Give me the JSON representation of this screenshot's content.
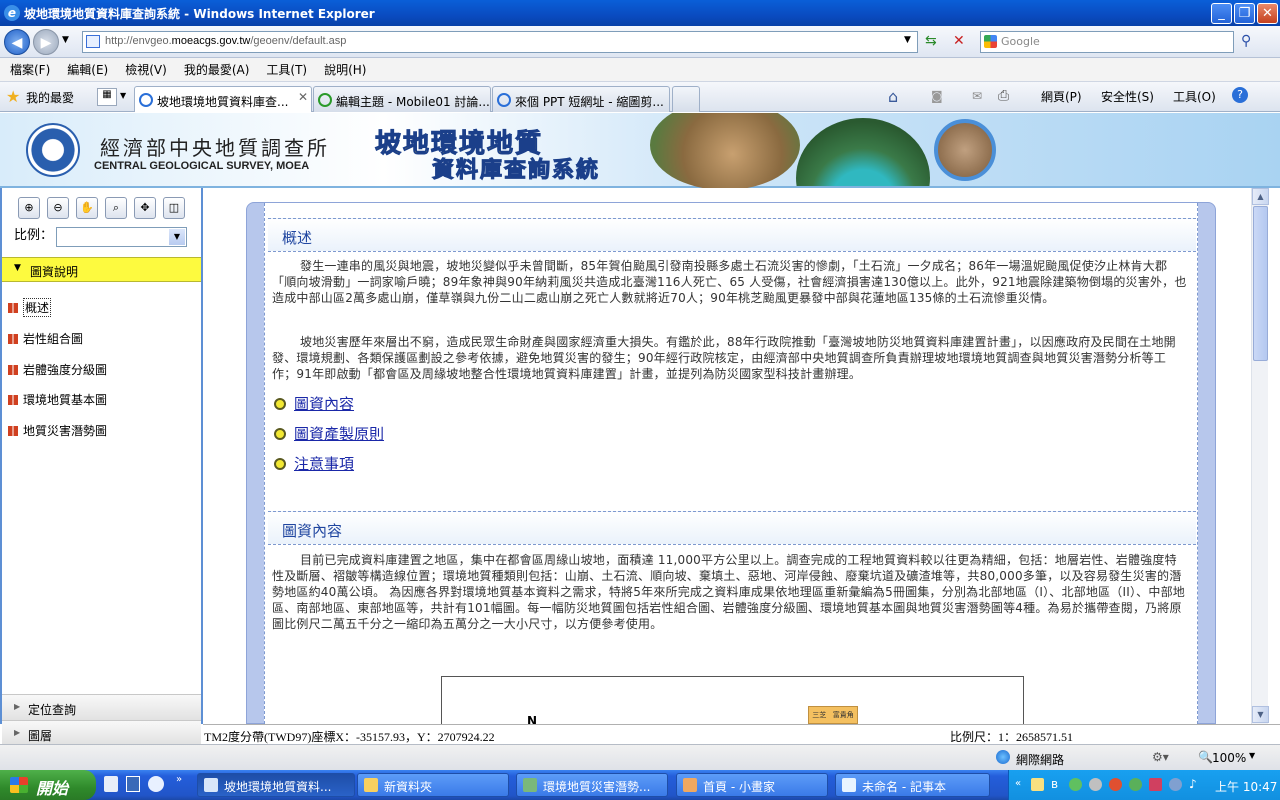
{
  "window": {
    "title": "坡地環境地質資料庫查詢系統 - Windows Internet Explorer"
  },
  "browser": {
    "url_prefix": "http://envgeo.",
    "url_host": "moeacgs.gov.tw",
    "url_path": "/geoenv/default.asp",
    "search_placeholder": "Google",
    "menu": [
      "檔案(F)",
      "編輯(E)",
      "檢視(V)",
      "我的最愛(A)",
      "工具(T)",
      "說明(H)"
    ],
    "favorites_label": "我的最愛",
    "tabs": [
      {
        "label": "坡地環境地質資料庫查..."
      },
      {
        "label": "編輯主題 - Mobile01 討論..."
      },
      {
        "label": "來個 PPT 短網址 - 縮圖剪..."
      }
    ],
    "toolbar_right": {
      "page": "網頁(P)",
      "safety": "安全性(S)",
      "tools": "工具(O)"
    }
  },
  "header": {
    "org_zh": "經濟部中央地質調查所",
    "org_en": "CENTRAL GEOLOGICAL SURVEY, MOEA",
    "system_line1": "坡地環境地質",
    "system_line2": "資料庫查詢系統"
  },
  "sidebar": {
    "scale_label": "比例：",
    "legend_header": "圖資說明",
    "items": [
      {
        "label": "概述"
      },
      {
        "label": "岩性組合圖"
      },
      {
        "label": "岩體強度分級圖"
      },
      {
        "label": "環境地質基本圖"
      },
      {
        "label": "地質災害潛勢圖"
      }
    ],
    "accordion": [
      {
        "label": "定位查詢"
      },
      {
        "label": "圖層"
      }
    ]
  },
  "content": {
    "section1_title": "概述",
    "section1_p1": "發生一連串的風災與地震，坡地災變似乎未曾間斷，85年賀伯颱風引發南投縣多處土石流災害的慘劇，「土石流」一夕成名；86年一場溫妮颱風促使汐止林肯大郡「順向坡滑動」一詞家喻戶曉；89年象神與90年納莉風災共造成北臺灣116人死亡、65 人受傷，社會經濟損害達130億以上。此外，921地震除建築物倒塌的災害外，也造成中部山區2萬多處山崩，僅草嶺與九份二山二處山崩之死亡人數就將近70人；90年桃芝颱風更暴發中部與花蓮地區135條的土石流慘重災情。",
    "section1_p2": "坡地災害歷年來層出不窮，造成民眾生命財產與國家經濟重大損失。有鑑於此，88年行政院推動「臺灣坡地防災地質資料庫建置計畫」，以因應政府及民間在土地開發、環境規劃、各類保護區劃設之參考依據，避免地質災害的發生；90年經行政院核定，由經濟部中央地質調查所負責辦理坡地環境地質調查與地質災害潛勢分析等工作；91年即啟動「都會區及周緣坡地整合性環境地質資料庫建置」計畫，並提列為防災國家型科技計畫辦理。",
    "links": [
      {
        "label": "圖資內容"
      },
      {
        "label": "圖資產製原則"
      },
      {
        "label": "注意事項"
      }
    ],
    "section2_title": "圖資內容",
    "section2_p1": "目前已完成資料庫建置之地區，集中在都會區周緣山坡地，面積達 11,000平方公里以上。調查完成的工程地質資料較以往更為精細，包括：地層岩性、岩體強度特性及斷層、褶皺等構造線位置；環境地質種類則包括：山崩、土石流、順向坡、棄填土、惡地、河岸侵蝕、廢棄坑道及礦渣堆等，共80,000多筆，以及容易發生災害的潛勢地區約40萬公頃。 為因應各界對環境地質基本資料之需求，特將5年來所完成之資料庫成果依地理區重新彙編為5冊圖集，分別為北部地區（I）、北部地區（II）、中部地區、南部地區、東部地區等，共計有101幅圖。每一幅防災地質圖包括岩性組合圖、岩體強度分級圖、環境地質基本圖與地質災害潛勢圖等4種。為易於攜帶查閱，乃將原圖比例尺二萬五千分之一縮印為五萬分之一大小尺寸，以方便參考使用。",
    "figure_north": "N",
    "figure_legend": [
      "三芝",
      "富貴角"
    ]
  },
  "coordbar": {
    "coords": "TM2度分帶(TWD97)座標X：-35157.93，Y：2707924.22",
    "scale": "比例尺：1：2658571.51"
  },
  "statusbar": {
    "zone": "網際網路",
    "zoom": "100%"
  },
  "taskbar": {
    "start": "開始",
    "tasks": [
      {
        "label": "坡地環境地質資料..."
      },
      {
        "label": "新資料夾"
      },
      {
        "label": "環境地質災害潛勢..."
      },
      {
        "label": "首頁 - 小畫家"
      },
      {
        "label": "未命名 - 記事本"
      }
    ],
    "clock": "上午 10:47"
  },
  "colors": {
    "accent": "#2046a0",
    "legend_header": "#fdfa3f",
    "taskbar": "#245edb"
  }
}
